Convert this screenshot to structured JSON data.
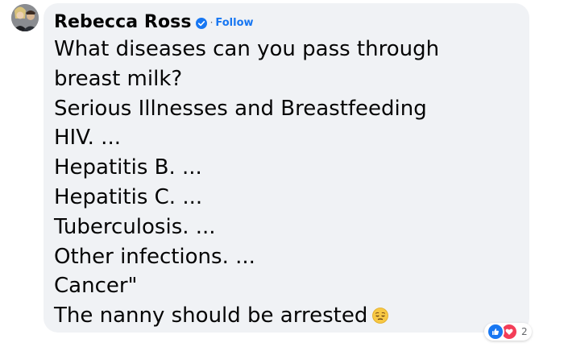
{
  "comment": {
    "author": "Rebecca Ross",
    "separator": "·",
    "follow_label": "Follow",
    "lines": [
      "What diseases can you pass through",
      "breast milk?",
      "Serious Illnesses and Breastfeeding",
      "HIV. ...",
      "Hepatitis B. ...",
      "Hepatitis C. ...",
      "Tuberculosis. ...",
      "Other infections. ...",
      "Cancer\"",
      "The nanny should be arrested"
    ],
    "trailing_emoji": "pensive-face-emoji",
    "reactions": {
      "icons": [
        "like-icon",
        "love-icon"
      ],
      "count": "2"
    }
  },
  "colors": {
    "bubble_bg": "#f0f2f5",
    "text": "#050505",
    "follow": "#1877f2",
    "like": "#1877f2",
    "love": "#f33e58",
    "muted": "#65676b"
  }
}
